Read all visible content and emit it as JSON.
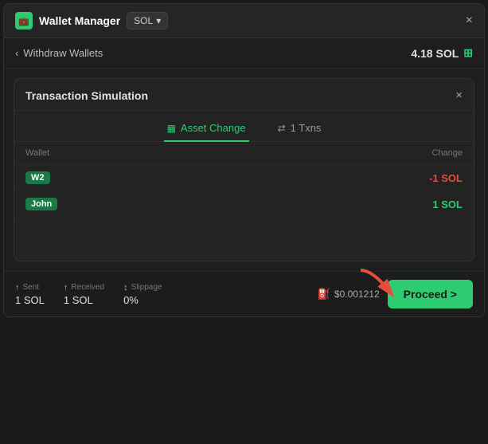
{
  "topBar": {
    "title": "Wallet Manager",
    "dropdownLabel": "SOL",
    "closeLabel": "×"
  },
  "breadcrumb": {
    "backArrow": "‹",
    "label": "Withdraw Wallets",
    "balance": "4.18 SOL"
  },
  "innerPanel": {
    "title": "Transaction Simulation",
    "closeLabel": "×",
    "tabs": [
      {
        "label": "Asset Change",
        "icon": "▦",
        "active": true
      },
      {
        "label": "1 Txns",
        "icon": "⇄",
        "active": false
      }
    ],
    "tableHeaders": {
      "wallet": "Wallet",
      "change": "Change"
    },
    "rows": [
      {
        "wallet": "W2",
        "change": "-1 SOL",
        "positive": false
      },
      {
        "wallet": "John",
        "change": "1 SOL",
        "positive": true
      }
    ]
  },
  "bottomBar": {
    "stats": [
      {
        "label": "Sent",
        "icon": "↑",
        "value": "1 SOL"
      },
      {
        "label": "Received",
        "icon": "↑",
        "value": "1 SOL"
      },
      {
        "label": "Slippage",
        "icon": "↕",
        "value": "0%"
      }
    ],
    "gasPrice": "$0.001212",
    "gasIcon": "⛽",
    "proceedLabel": "Proceed >"
  }
}
